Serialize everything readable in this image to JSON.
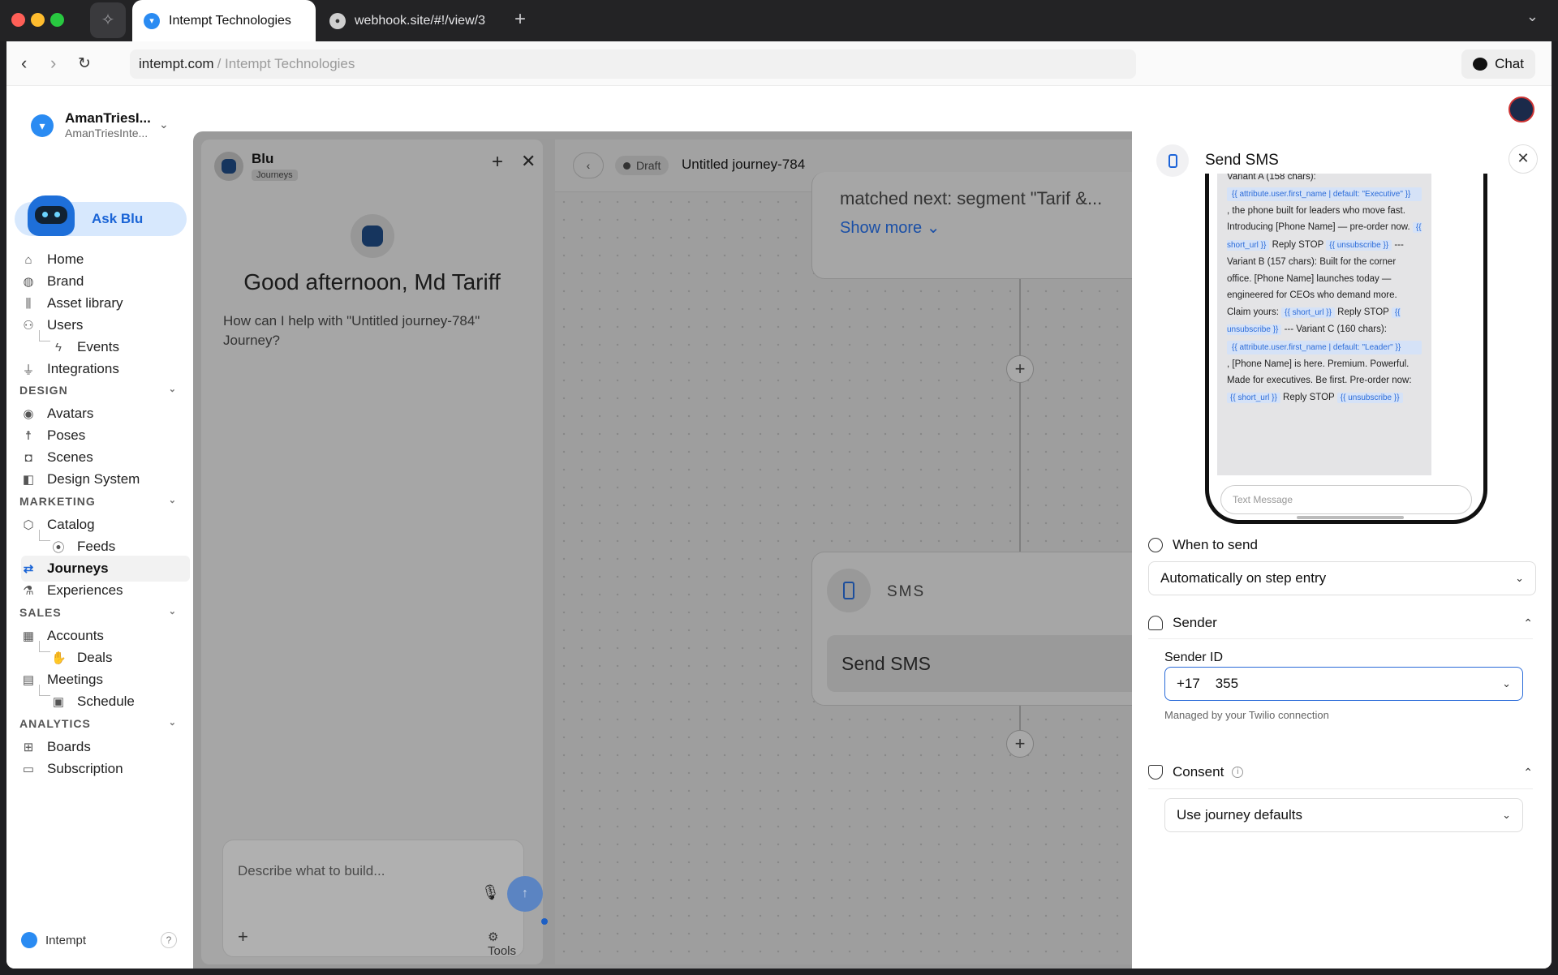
{
  "browser": {
    "tabs": [
      {
        "title": "Intempt Technologies"
      },
      {
        "title": "webhook.site/#!/view/3"
      }
    ],
    "url_domain": "intempt.com",
    "url_rest": "/ Intempt Technologies",
    "chat_label": "Chat"
  },
  "workspace": {
    "name": "AmanTriesI...",
    "sub": "AmanTriesInte..."
  },
  "sidebar": {
    "ask_blu": "Ask Blu",
    "items": [
      {
        "label": "Home"
      },
      {
        "label": "Brand"
      },
      {
        "label": "Asset library"
      },
      {
        "label": "Users"
      },
      {
        "label": "Events"
      },
      {
        "label": "Integrations"
      },
      {
        "label": "Avatars"
      },
      {
        "label": "Poses"
      },
      {
        "label": "Scenes"
      },
      {
        "label": "Design System"
      },
      {
        "label": "Catalog"
      },
      {
        "label": "Feeds"
      },
      {
        "label": "Journeys"
      },
      {
        "label": "Experiences"
      },
      {
        "label": "Accounts"
      },
      {
        "label": "Deals"
      },
      {
        "label": "Meetings"
      },
      {
        "label": "Schedule"
      },
      {
        "label": "Boards"
      },
      {
        "label": "Subscription"
      }
    ],
    "sections": {
      "design": "DESIGN",
      "marketing": "MARKETING",
      "sales": "SALES",
      "analytics": "ANALYTICS"
    },
    "footer": "Intempt",
    "help": "?"
  },
  "blu": {
    "name": "Blu",
    "badge": "Journeys",
    "greeting": "Good afternoon, Md Tariff",
    "help": "How can I help with \"Untitled journey-784\" Journey?",
    "placeholder": "Describe what to build...",
    "tools": "Tools"
  },
  "canvas": {
    "status": "Draft",
    "title": "Untitled journey-784",
    "card1_text": "matched next: segment \"Tarif &...",
    "show_more": "Show more",
    "node_type": "SMS",
    "node_title": "Send SMS"
  },
  "panel": {
    "title": "Send SMS",
    "sms": {
      "l1": "Variant A (158 chars):",
      "t1": "{{ attribute.user.first_name | default: \"Executive\" }}",
      "l2": ", the phone built for leaders who move fast. Introducing [Phone Name] — pre-order now.",
      "t2": "{{ short_url }}",
      "l3": "Reply STOP",
      "t3": "{{ unsubscribe }}",
      "l4": "--- Variant B (157 chars): Built for the corner office. [Phone Name] launches today — engineered for CEOs who demand more. Claim yours:",
      "t4": "{{ short_url }}",
      "l5": "Reply STOP",
      "t5": "{{ unsubscribe }}",
      "l6": "--- Variant C (160 chars):",
      "t6": "{{ attribute.user.first_name | default: \"Leader\" }}",
      "l7": ", [Phone Name] is here. Premium. Powerful. Made for executives. Be first. Pre-order now:",
      "t7": "{{ short_url }}",
      "l8": "Reply STOP",
      "t8": "{{ unsubscribe }}"
    },
    "text_message_placeholder": "Text Message",
    "when_to_send": {
      "label": "When to send",
      "value": "Automatically on step entry"
    },
    "sender": {
      "label": "Sender",
      "field_label": "Sender ID",
      "value": "+17    355",
      "hint": "Managed by your Twilio connection"
    },
    "consent": {
      "label": "Consent",
      "value": "Use journey defaults"
    }
  }
}
